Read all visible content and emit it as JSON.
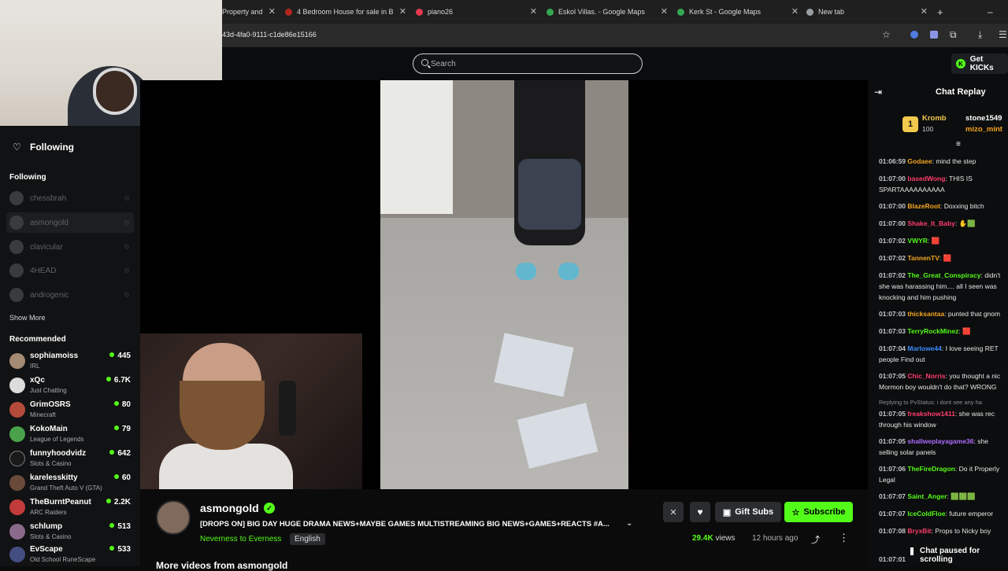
{
  "browser": {
    "tabs": [
      {
        "label": "Property and",
        "color": "#5a5a5a"
      },
      {
        "label": "4 Bedroom House for sale in B",
        "color": "#b3261e"
      },
      {
        "label": "piano26",
        "color": "#e53950"
      },
      {
        "label": "Eskol Villas. - Google Maps",
        "color": "#34a853"
      },
      {
        "label": "Kerk St - Google Maps",
        "color": "#34a853"
      },
      {
        "label": "New tab",
        "color": "#9aa0a6"
      }
    ],
    "url": "43d-4fa0-9111-c1de86e15166"
  },
  "site": {
    "search_placeholder": "Search",
    "get_kicks": "Get KICKs"
  },
  "sidebar": {
    "following_header": "Following",
    "following_section": "Following",
    "following": [
      {
        "name": "chessbrah"
      },
      {
        "name": "asmongold"
      },
      {
        "name": "clavicular"
      },
      {
        "name": "4HEAD"
      },
      {
        "name": "androgenic"
      }
    ],
    "show_more": "Show More",
    "recommended_section": "Recommended",
    "recommended": [
      {
        "name": "sophiamoiss",
        "category": "IRL",
        "viewers": "445"
      },
      {
        "name": "xQc",
        "category": "Just Chatting",
        "viewers": "6.7K"
      },
      {
        "name": "GrimOSRS",
        "category": "Minecraft",
        "viewers": "80"
      },
      {
        "name": "KokoMain",
        "category": "League of Legends",
        "viewers": "79"
      },
      {
        "name": "funnyhoodvidz",
        "category": "Slots & Casino",
        "viewers": "642"
      },
      {
        "name": "karelesskitty",
        "category": "Grand Theft Auto V (GTA)",
        "viewers": "60"
      },
      {
        "name": "TheBurntPeanut",
        "category": "ARC Raiders",
        "viewers": "2.2K"
      },
      {
        "name": "schlump",
        "category": "Slots & Casino",
        "viewers": "513"
      },
      {
        "name": "EvScape",
        "category": "Old School RuneScape",
        "viewers": "533"
      }
    ]
  },
  "stream": {
    "channel": "asmongold",
    "verified": "✓",
    "title": "[DROPS ON] BIG DAY HUGE DRAMA NEWS+MAYBE GAMES MULTISTREAMING BIG NEWS+GAMES+REACTS #A...",
    "category": "Neverness to Everness",
    "language": "English",
    "gift_subs": "Gift Subs",
    "subscribe": "Subscribe",
    "views": "29.4K",
    "views_label": "views",
    "ago": "12 hours ago",
    "more_videos": "More videos from asmongold"
  },
  "chat": {
    "title": "Chat Replay",
    "pinned": {
      "rank": "1",
      "name": "Kromb",
      "amount": "100",
      "user2": "stone1549",
      "user3": "mizo_mint"
    },
    "messages": [
      {
        "time": "01:06:59",
        "user": "Godaee",
        "color": "#f5a623",
        "text": "mind the step"
      },
      {
        "time": "01:07:00",
        "user": "basedWong",
        "color": "#ff3d6e",
        "text": "THIS IS SPARTAAAAAAAAAA"
      },
      {
        "time": "01:07:00",
        "user": "BlazeRoot",
        "color": "#f5a623",
        "text": "Doxxing bitch"
      },
      {
        "time": "01:07:00",
        "user": "Shake_It_Baby",
        "color": "#ff3d6e",
        "text": ""
      },
      {
        "time": "01:07:02",
        "user": "VWYR",
        "color": "#53fc18",
        "text": ""
      },
      {
        "time": "01:07:02",
        "user": "TannenTV",
        "color": "#f5a623",
        "text": ""
      },
      {
        "time": "01:07:02",
        "user": "The_Great_Conspiracy",
        "color": "#53fc18",
        "text": "didn't she was harassing him.... all I seen was knocking and him pushing"
      },
      {
        "time": "01:07:03",
        "user": "thicksantaa",
        "color": "#f5a623",
        "text": "punted that gnom"
      },
      {
        "time": "01:07:03",
        "user": "TerryRockMinez",
        "color": "#53fc18",
        "text": ""
      },
      {
        "time": "01:07:04",
        "user": "Marlowe44",
        "color": "#3d8bff",
        "text": "I love seeing RET people Find out"
      },
      {
        "time": "01:07:05",
        "user": "Chic_Norris",
        "color": "#ff3d6e",
        "text": "you thought a nic Mormon boy wouldn't do that? WRONG"
      },
      {
        "time": "01:07:05",
        "user": "freakshow1411",
        "color": "#ff3d6e",
        "text": "she was rec through his window",
        "reply": "Replying to PvStatus: i dont see any ha"
      },
      {
        "time": "01:07:05",
        "user": "shallweplayagame36",
        "color": "#b06bff",
        "text": "she selling solar panels"
      },
      {
        "time": "01:07:06",
        "user": "TheFireDragon",
        "color": "#53fc18",
        "text": "Do it Properly Legal"
      },
      {
        "time": "01:07:07",
        "user": "Saint_Anger",
        "color": "#53fc18",
        "text": ""
      },
      {
        "time": "01:07:07",
        "user": "IceColdFloe",
        "color": "#53fc18",
        "text": "future emperor"
      },
      {
        "time": "01:07:08",
        "user": "BryxBit",
        "color": "#ff3d6e",
        "text": "Props to Nicky boy"
      },
      {
        "time": "01:07:01",
        "user": "",
        "color": "#53fc18",
        "text": ""
      }
    ],
    "paused": "Chat paused for scrolling"
  },
  "colors": {
    "accent": "#53fc18",
    "background": "#0b0b0c"
  }
}
